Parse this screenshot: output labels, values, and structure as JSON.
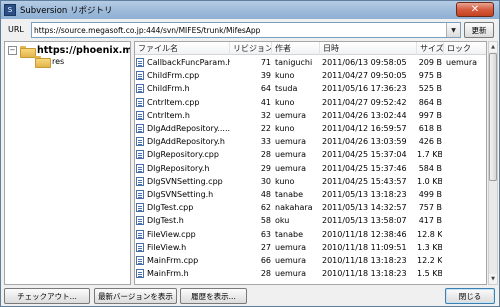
{
  "window": {
    "title": "Subversion リポジトリ"
  },
  "url_bar": {
    "label": "URL",
    "value": "https://source.megasoft.co.jp:444/svn/MIFES/trunk/MifesApp",
    "refresh_label": "更新"
  },
  "tree": {
    "root_label": "https://phoenix.megaso",
    "child_label": "res"
  },
  "file_list": {
    "columns": [
      "ファイル名",
      "リビジョン",
      "作者",
      "日時",
      "サイズ",
      "ロック"
    ],
    "rows": [
      {
        "name": "CallbackFuncParam.h",
        "rev": "71",
        "author": "taniguchi",
        "date": "2011/06/13 09:58:05",
        "size": "209 B",
        "lock": "uemura"
      },
      {
        "name": "ChildFrm.cpp",
        "rev": "39",
        "author": "kuno",
        "date": "2011/04/27 09:50:05",
        "size": "975 B",
        "lock": ""
      },
      {
        "name": "ChildFrm.h",
        "rev": "64",
        "author": "tsuda",
        "date": "2011/05/16 17:36:23",
        "size": "525 B",
        "lock": ""
      },
      {
        "name": "CntrItem.cpp",
        "rev": "41",
        "author": "kuno",
        "date": "2011/04/27 09:52:42",
        "size": "864 B",
        "lock": ""
      },
      {
        "name": "CntrItem.h",
        "rev": "32",
        "author": "uemura",
        "date": "2011/04/26 13:02:44",
        "size": "997 B",
        "lock": ""
      },
      {
        "name": "DlgAddRepository.....",
        "rev": "22",
        "author": "kuno",
        "date": "2011/04/12 16:59:57",
        "size": "618 B",
        "lock": ""
      },
      {
        "name": "DlgAddRepository.h",
        "rev": "33",
        "author": "uemura",
        "date": "2011/04/26 13:03:59",
        "size": "426 B",
        "lock": ""
      },
      {
        "name": "DlgRepository.cpp",
        "rev": "28",
        "author": "uemura",
        "date": "2011/04/25 15:37:04",
        "size": "1.7 KB",
        "lock": ""
      },
      {
        "name": "DlgRepository.h",
        "rev": "29",
        "author": "uemura",
        "date": "2011/04/25 15:37:46",
        "size": "584 B",
        "lock": ""
      },
      {
        "name": "DlgSVNSetting.cpp",
        "rev": "30",
        "author": "kuno",
        "date": "2011/04/25 15:43:57",
        "size": "1.0 KB",
        "lock": ""
      },
      {
        "name": "DlgSVNSetting.h",
        "rev": "48",
        "author": "tanabe",
        "date": "2011/05/13 13:18:23",
        "size": "499 B",
        "lock": ""
      },
      {
        "name": "DlgTest.cpp",
        "rev": "62",
        "author": "nakahara",
        "date": "2011/05/13 14:32:57",
        "size": "757 B",
        "lock": ""
      },
      {
        "name": "DlgTest.h",
        "rev": "58",
        "author": "oku",
        "date": "2011/05/13 13:58:07",
        "size": "417 B",
        "lock": ""
      },
      {
        "name": "FileView.cpp",
        "rev": "63",
        "author": "tanabe",
        "date": "2010/11/18 12:38:46",
        "size": "12.8 KB",
        "lock": ""
      },
      {
        "name": "FileView.h",
        "rev": "27",
        "author": "uemura",
        "date": "2010/11/18 11:09:51",
        "size": "1.3 KB",
        "lock": ""
      },
      {
        "name": "MainFrm.cpp",
        "rev": "66",
        "author": "uemura",
        "date": "2010/11/18 13:18:23",
        "size": "12.2 KB",
        "lock": ""
      },
      {
        "name": "MainFrm.h",
        "rev": "28",
        "author": "uemura",
        "date": "2010/11/18 13:18:23",
        "size": "1.5 KB",
        "lock": ""
      }
    ]
  },
  "buttons": {
    "checkout": "チェックアウト...",
    "show_latest": "最新バージョンを表示",
    "show_history": "履歴を表示...",
    "close": "閉じる"
  },
  "icons": {
    "app": "subversion-icon",
    "close": "close-icon",
    "dropdown": "chevron-down-icon",
    "folder": "folder-icon",
    "file": "file-icon"
  }
}
